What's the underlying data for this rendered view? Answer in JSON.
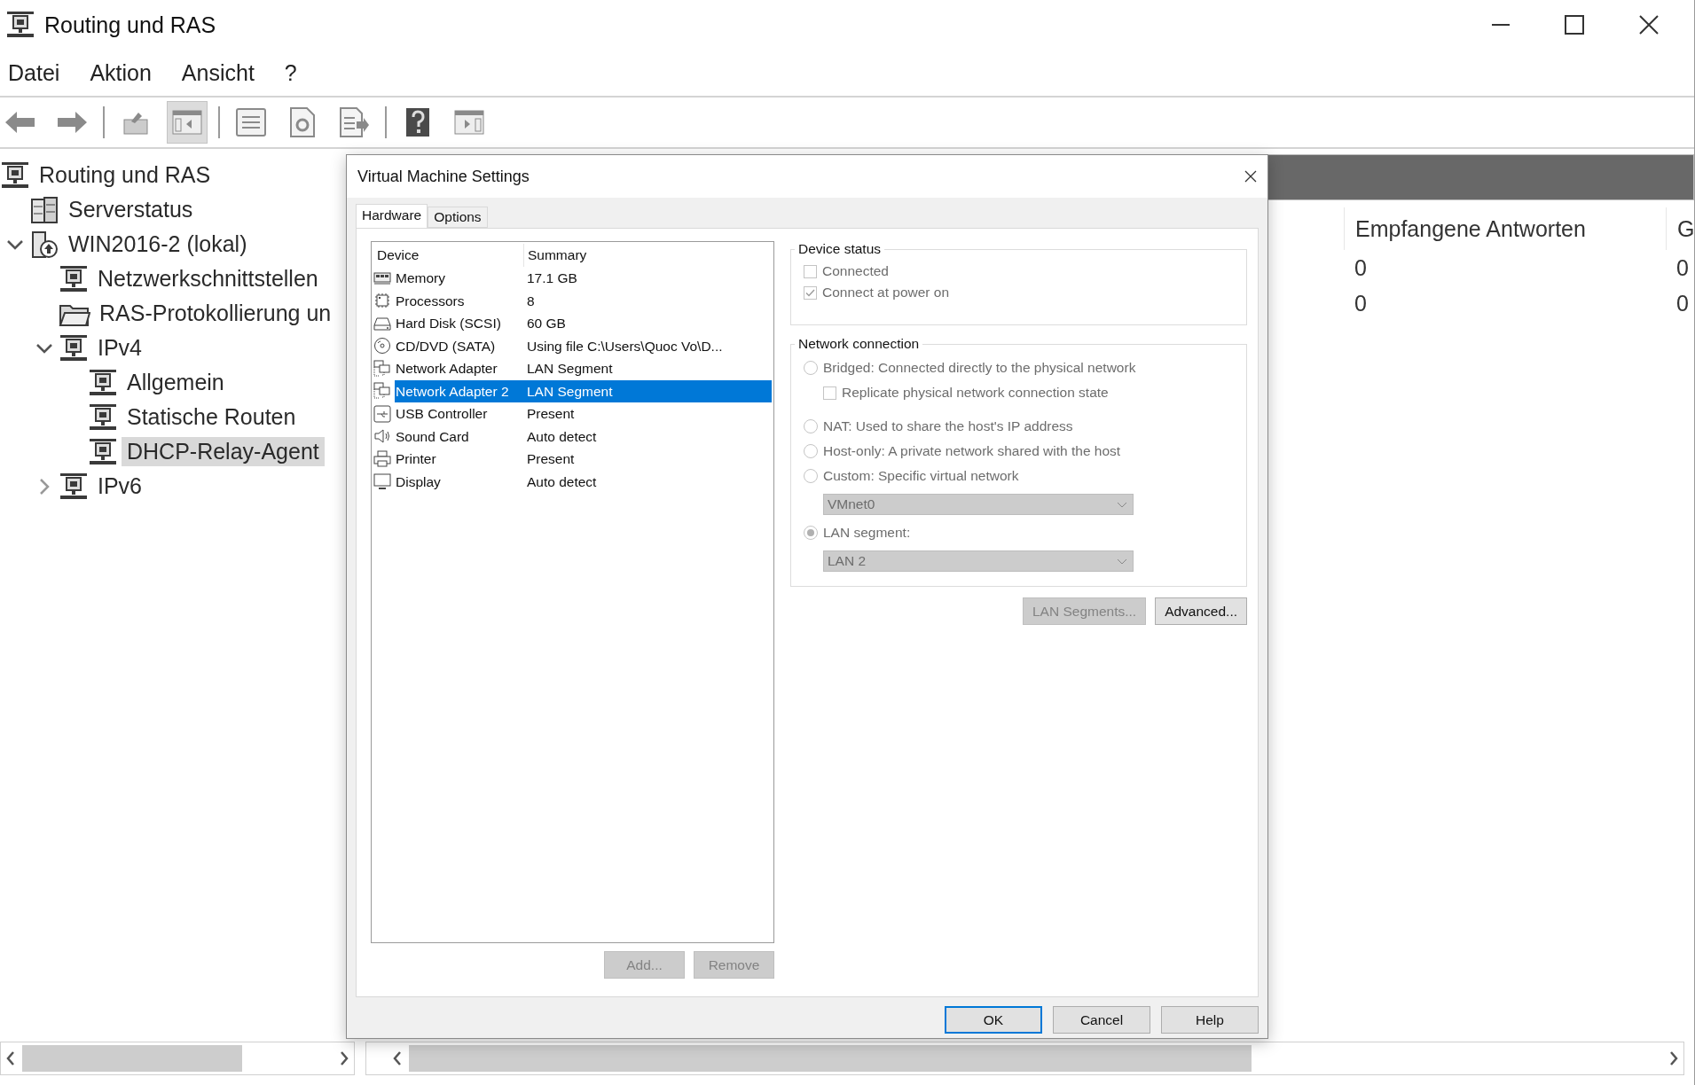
{
  "window": {
    "title": "Routing und RAS"
  },
  "menu": [
    "Datei",
    "Aktion",
    "Ansicht",
    "?"
  ],
  "toolbar": [
    {
      "kind": "back",
      "pressed": false
    },
    {
      "kind": "forward",
      "pressed": false
    },
    {
      "kind": "separator"
    },
    {
      "kind": "up",
      "pressed": false
    },
    {
      "kind": "tree-toggle",
      "pressed": true
    },
    {
      "kind": "separator"
    },
    {
      "kind": "properties",
      "pressed": false
    },
    {
      "kind": "refresh",
      "pressed": false
    },
    {
      "kind": "export",
      "pressed": false
    },
    {
      "kind": "separator"
    },
    {
      "kind": "help",
      "pressed": false
    },
    {
      "kind": "action-pane",
      "pressed": false
    }
  ],
  "tree": [
    {
      "label": "Routing und RAS",
      "kind": "network",
      "selected": false,
      "children": [
        {
          "label": "Serverstatus",
          "kind": "servers",
          "selected": false
        },
        {
          "label": "WIN2016-2 (lokal)",
          "kind": "computer",
          "selected": false,
          "expanded": true,
          "children": [
            {
              "label": "Netzwerkschnittstellen",
              "kind": "network",
              "selected": false
            },
            {
              "label": "RAS-Protokollierung un",
              "kind": "folder",
              "selected": false
            },
            {
              "label": "IPv4",
              "kind": "network",
              "selected": false,
              "expanded": true,
              "children": [
                {
                  "label": "Allgemein",
                  "kind": "network",
                  "selected": false
                },
                {
                  "label": "Statische Routen",
                  "kind": "network",
                  "selected": false
                },
                {
                  "label": "DHCP-Relay-Agent",
                  "kind": "network",
                  "selected": true
                }
              ]
            },
            {
              "label": "IPv6",
              "kind": "network",
              "selected": false,
              "expanded": false
            }
          ]
        }
      ]
    }
  ],
  "results": {
    "columns": [
      "Empfangene Antworten",
      "G"
    ],
    "rows": [
      [
        "0",
        "0"
      ],
      [
        "0",
        "0"
      ]
    ]
  },
  "dialog": {
    "title": "Virtual Machine Settings",
    "tabs": [
      {
        "label": "Hardware",
        "selected": true
      },
      {
        "label": "Options",
        "selected": false
      }
    ],
    "devices": {
      "columns": [
        "Device",
        "Summary"
      ],
      "rows": [
        {
          "kind": "memory",
          "device": "Memory",
          "summary": "17.1 GB",
          "selected": false
        },
        {
          "kind": "cpu",
          "device": "Processors",
          "summary": "8",
          "selected": false
        },
        {
          "kind": "disk",
          "device": "Hard Disk (SCSI)",
          "summary": "60 GB",
          "selected": false
        },
        {
          "kind": "cdrom",
          "device": "CD/DVD (SATA)",
          "summary": "Using file C:\\Users\\Quoc Vo\\D...",
          "selected": false
        },
        {
          "kind": "network",
          "device": "Network Adapter",
          "summary": "LAN Segment",
          "selected": false
        },
        {
          "kind": "network",
          "device": "Network Adapter 2",
          "summary": "LAN Segment",
          "selected": true
        },
        {
          "kind": "usb",
          "device": "USB Controller",
          "summary": "Present",
          "selected": false
        },
        {
          "kind": "sound",
          "device": "Sound Card",
          "summary": "Auto detect",
          "selected": false
        },
        {
          "kind": "printer",
          "device": "Printer",
          "summary": "Present",
          "selected": false
        },
        {
          "kind": "display",
          "device": "Display",
          "summary": "Auto detect",
          "selected": false
        }
      ]
    },
    "list_buttons": [
      {
        "label": "Add...",
        "disabled": true
      },
      {
        "label": "Remove",
        "disabled": true
      }
    ],
    "device_status": {
      "title": "Device status",
      "items": [
        {
          "label": "Connected",
          "checked": false,
          "disabled": true
        },
        {
          "label": "Connect at power on",
          "checked": true,
          "disabled": true
        }
      ]
    },
    "network_connection": {
      "title": "Network connection",
      "items": [
        {
          "kind": "radio",
          "label": "Bridged: Connected directly to the physical network",
          "selected": false,
          "disabled": true
        },
        {
          "kind": "checkbox",
          "label": "Replicate physical network connection state",
          "checked": false,
          "disabled": true
        },
        {
          "kind": "radio",
          "label": "NAT: Used to share the host's IP address",
          "selected": false,
          "disabled": true
        },
        {
          "kind": "radio",
          "label": "Host-only: A private network shared with the host",
          "selected": false,
          "disabled": true
        },
        {
          "kind": "radio",
          "label": "Custom: Specific virtual network",
          "selected": false,
          "disabled": true
        },
        {
          "kind": "dropdown",
          "value": "VMnet0",
          "disabled": true
        },
        {
          "kind": "radio",
          "label": "LAN segment:",
          "selected": true,
          "disabled": true
        },
        {
          "kind": "dropdown",
          "value": "LAN 2",
          "disabled": true
        }
      ]
    },
    "panel_buttons": [
      {
        "label": "LAN Segments...",
        "disabled": true
      },
      {
        "label": "Advanced...",
        "disabled": false
      }
    ],
    "footer_buttons": [
      {
        "label": "OK",
        "default": true
      },
      {
        "label": "Cancel",
        "default": false
      },
      {
        "label": "Help",
        "default": false
      }
    ]
  }
}
